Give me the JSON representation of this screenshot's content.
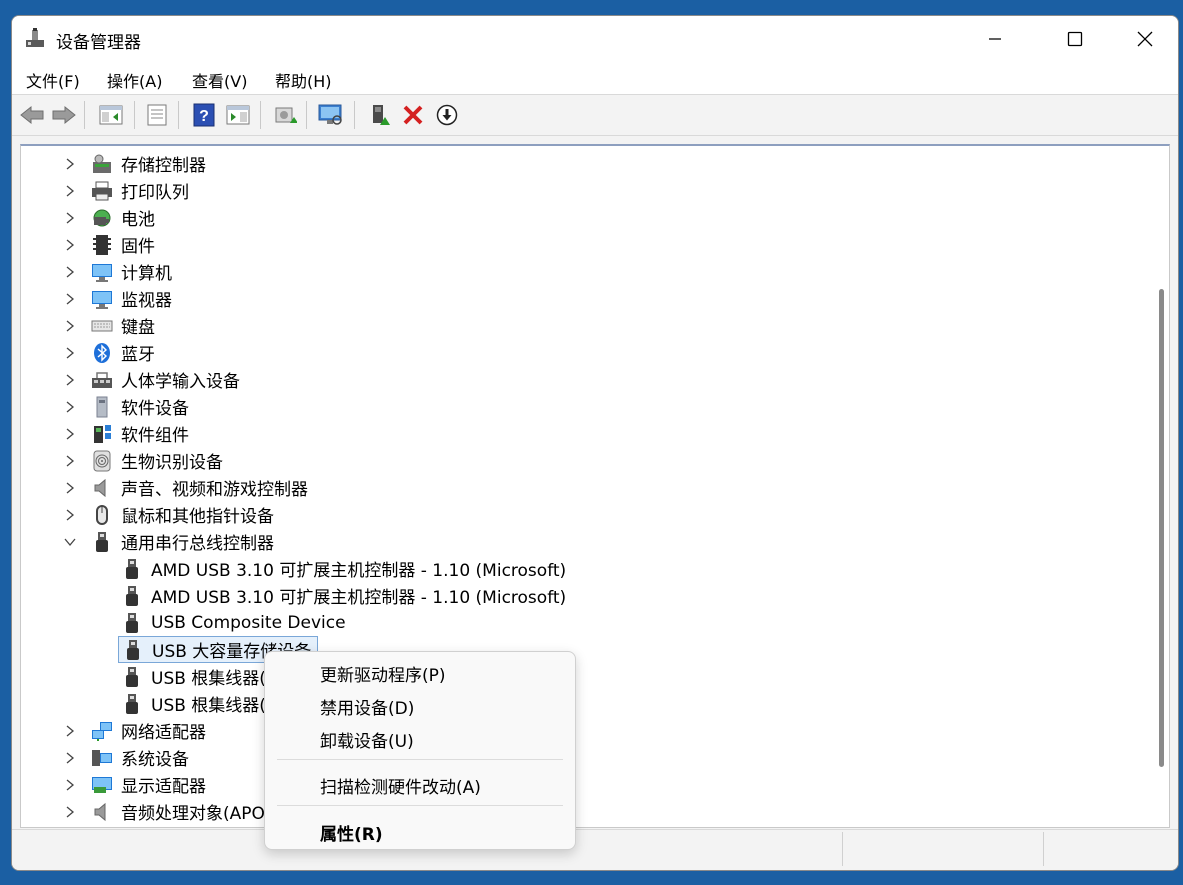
{
  "window": {
    "title": "设备管理器"
  },
  "menubar": {
    "items": [
      {
        "label": "文件(F)"
      },
      {
        "label": "操作(A)"
      },
      {
        "label": "查看(V)"
      },
      {
        "label": "帮助(H)"
      }
    ]
  },
  "toolbar": {
    "buttons": [
      {
        "icon": "back-arrow-icon"
      },
      {
        "icon": "forward-arrow-icon"
      },
      {
        "icon": "show-hide-console-tree-icon"
      },
      {
        "icon": "properties-sheet-icon"
      },
      {
        "icon": "help-icon"
      },
      {
        "icon": "action-pane-icon"
      },
      {
        "icon": "update-driver-icon"
      },
      {
        "icon": "scan-hardware-icon"
      },
      {
        "icon": "enable-device-icon"
      },
      {
        "icon": "uninstall-device-icon"
      },
      {
        "icon": "disable-device-icon"
      }
    ]
  },
  "tree": {
    "items": [
      {
        "label": "存储控制器",
        "icon": "storage-controller-icon",
        "expanded": false
      },
      {
        "label": "打印队列",
        "icon": "printer-icon",
        "expanded": false
      },
      {
        "label": "电池",
        "icon": "battery-icon",
        "expanded": false
      },
      {
        "label": "固件",
        "icon": "firmware-icon",
        "expanded": false
      },
      {
        "label": "计算机",
        "icon": "computer-icon",
        "expanded": false
      },
      {
        "label": "监视器",
        "icon": "monitor-icon",
        "expanded": false
      },
      {
        "label": "键盘",
        "icon": "keyboard-icon",
        "expanded": false
      },
      {
        "label": "蓝牙",
        "icon": "bluetooth-icon",
        "expanded": false
      },
      {
        "label": "人体学输入设备",
        "icon": "hid-icon",
        "expanded": false
      },
      {
        "label": "软件设备",
        "icon": "software-device-icon",
        "expanded": false
      },
      {
        "label": "软件组件",
        "icon": "software-component-icon",
        "expanded": false
      },
      {
        "label": "生物识别设备",
        "icon": "fingerprint-icon",
        "expanded": false
      },
      {
        "label": "声音、视频和游戏控制器",
        "icon": "speaker-icon",
        "expanded": false
      },
      {
        "label": "鼠标和其他指针设备",
        "icon": "mouse-icon",
        "expanded": false
      },
      {
        "label": "通用串行总线控制器",
        "icon": "usb-icon",
        "expanded": true
      },
      {
        "label": "AMD USB 3.10 可扩展主机控制器 - 1.10 (Microsoft)",
        "icon": "usb-icon",
        "child": true
      },
      {
        "label": "AMD USB 3.10 可扩展主机控制器 - 1.10 (Microsoft)",
        "icon": "usb-icon",
        "child": true
      },
      {
        "label": "USB Composite Device",
        "icon": "usb-icon",
        "child": true
      },
      {
        "label": "USB 大容量存储设备",
        "icon": "usb-icon",
        "child": true,
        "selected": true
      },
      {
        "label": "USB 根集线器(U",
        "icon": "usb-icon",
        "child": true
      },
      {
        "label": "USB 根集线器(U",
        "icon": "usb-icon",
        "child": true
      },
      {
        "label": "网络适配器",
        "icon": "network-adapter-icon",
        "expanded": false
      },
      {
        "label": "系统设备",
        "icon": "system-device-icon",
        "expanded": false
      },
      {
        "label": "显示适配器",
        "icon": "display-adapter-icon",
        "expanded": false
      },
      {
        "label": "音频处理对象(APO",
        "icon": "speaker-icon",
        "expanded": false
      }
    ]
  },
  "context_menu": {
    "items": [
      {
        "label": "更新驱动程序(P)"
      },
      {
        "label": "禁用设备(D)"
      },
      {
        "label": "卸载设备(U)"
      },
      {
        "label": "扫描检测硬件改动(A)"
      },
      {
        "label": "属性(R)",
        "bold": true
      }
    ]
  }
}
